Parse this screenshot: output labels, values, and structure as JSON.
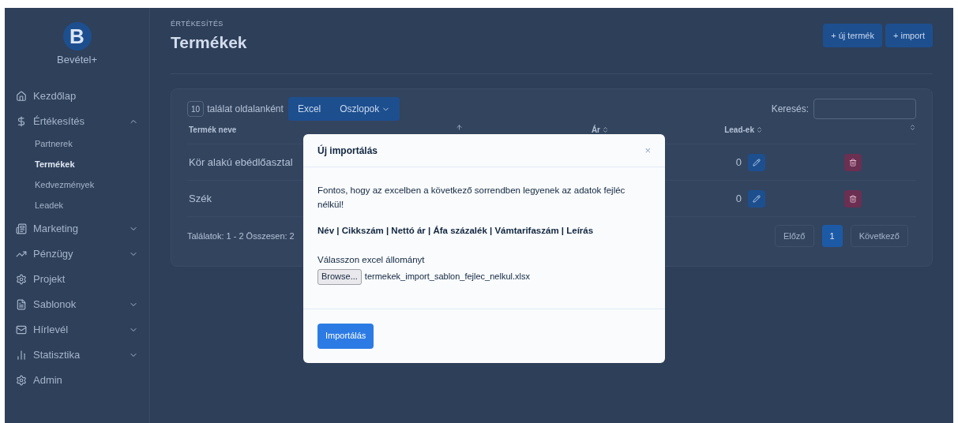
{
  "sidebar": {
    "logo_letter": "B",
    "brand": "Bevétel+",
    "items": [
      {
        "label": "Kezdőlap"
      },
      {
        "label": "Értékesítés",
        "expanded": true,
        "children": [
          {
            "label": "Partnerek",
            "selected": false
          },
          {
            "label": "Termékek",
            "selected": true
          },
          {
            "label": "Kedvezmények",
            "selected": false
          },
          {
            "label": "Leadek",
            "selected": false
          }
        ]
      },
      {
        "label": "Marketing",
        "expanded": false
      },
      {
        "label": "Pénzügy",
        "expanded": false
      },
      {
        "label": "Projekt"
      },
      {
        "label": "Sablonok",
        "expanded": false
      },
      {
        "label": "Hírlevél",
        "expanded": false
      },
      {
        "label": "Statisztika",
        "expanded": false
      },
      {
        "label": "Admin"
      }
    ]
  },
  "header": {
    "breadcrumb": "ÉRTÉKESÍTÉS",
    "title": "Termékek",
    "buttons": [
      "+ új termék",
      "+ import"
    ]
  },
  "toolbar": {
    "page_size": "10",
    "page_size_label": "találat oldalanként",
    "buttons": [
      "Excel",
      "Oszlopok"
    ],
    "search_label": "Keresés:"
  },
  "table": {
    "columns": [
      "Termék neve",
      "Ár",
      "Lead-ek"
    ],
    "rows": [
      {
        "name": "Kör alakú ebédlőasztal",
        "leads": "0"
      },
      {
        "name": "Szék",
        "leads": "0"
      }
    ]
  },
  "footer": {
    "summary": "Találatok: 1 - 2 Összesen: 2",
    "pagination": [
      {
        "label": "Előző",
        "selected": false
      },
      {
        "label": "1",
        "selected": true
      },
      {
        "label": "Következő",
        "selected": false
      }
    ]
  },
  "modal": {
    "title": "Új importálás",
    "close": "×",
    "intro": "Fontos, hogy az excelben a következő sorrendben legyenek az adatok fejléc nélkül!",
    "columns_line": "Név | Cikkszám | Nettó ár | Áfa százalék | Vámtarifaszám | Leírás",
    "file_label": "Válasszon excel állományt",
    "browse": "Browse...",
    "file_name": "termekek_import_sablon_fejlec_nelkul.xlsx",
    "submit": "Importálás"
  }
}
